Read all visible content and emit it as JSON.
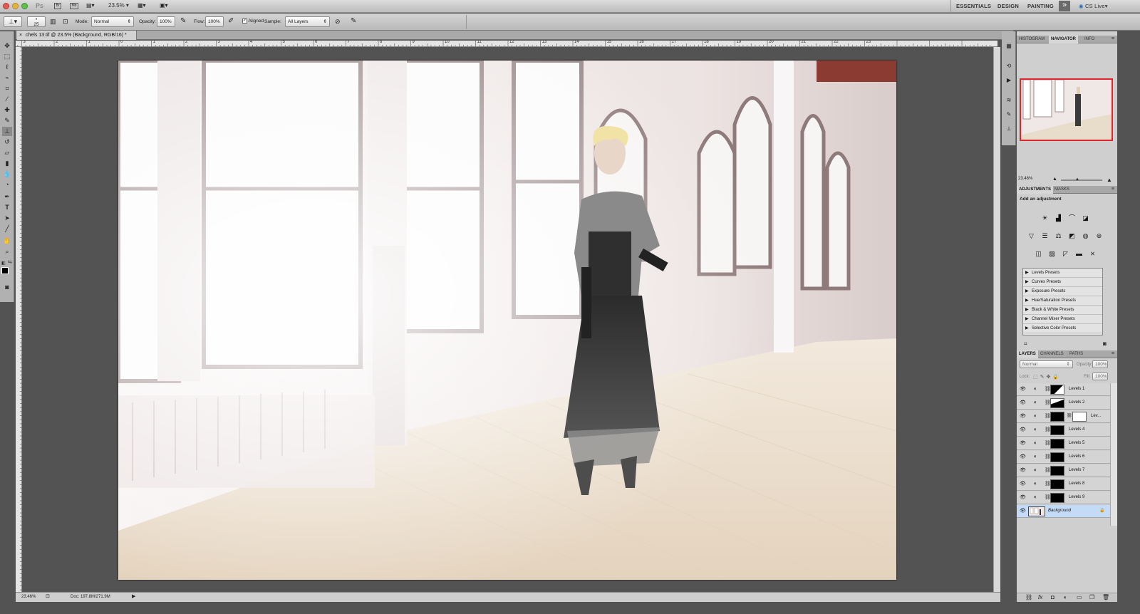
{
  "app": {
    "name": "Ps",
    "zoom_menu": "23.5%",
    "workspaces": [
      "ESSENTIALS",
      "DESIGN",
      "PAINTING"
    ],
    "overflow": "»",
    "cs_live": "CS Live"
  },
  "options": {
    "brush_size": "25",
    "mode_label": "Mode:",
    "mode_value": "Normal",
    "opacity_label": "Opacity:",
    "opacity_value": "100%",
    "flow_label": "Flow:",
    "flow_value": "100%",
    "aligned_label": "Aligned",
    "sample_label": "Sample:",
    "sample_value": "All Layers"
  },
  "document": {
    "tab_title": "chels 13.tif @ 23.5% (Background, RGB/16) *",
    "ruler_numbers": [
      "3",
      "2",
      "1",
      "0",
      "1",
      "2",
      "3",
      "4",
      "5",
      "6",
      "7",
      "8",
      "9",
      "10",
      "11",
      "12",
      "13",
      "14",
      "15",
      "16",
      "17",
      "18",
      "19",
      "20",
      "21",
      "22",
      "23"
    ]
  },
  "status": {
    "zoom": "23.46%",
    "doc_info": "Doc: 197.8M/271.9M"
  },
  "navigator": {
    "tabs": [
      "HISTOGRAM",
      "NAVIGATOR",
      "INFO"
    ],
    "zoom": "23.46%"
  },
  "adjustments": {
    "tabs": [
      "ADJUSTMENTS",
      "MASKS"
    ],
    "heading": "Add an adjustment",
    "presets": [
      "Levels Presets",
      "Curves Presets",
      "Exposure Presets",
      "Hue/Saturation Presets",
      "Black & White Presets",
      "Channel Mixer Presets",
      "Selective Color Presets"
    ]
  },
  "layers": {
    "tabs": [
      "LAYERS",
      "CHANNELS",
      "PATHS"
    ],
    "blend_mode": "Normal",
    "opacity_label": "Opacity:",
    "opacity_value": "100%",
    "lock_label": "Lock:",
    "fill_label": "Fill:",
    "fill_value": "100%",
    "items": [
      "Levels 1",
      "Levels 2",
      "Lev...",
      "Levels 4",
      "Levels 5",
      "Levels 6",
      "Levels 7",
      "Levels 8",
      "Levels 9",
      "Background"
    ],
    "selected_index": 9
  },
  "colors": {
    "accent": "#c3dbf6",
    "nav_view_box": "#e0242a",
    "wall_trim": "#8d7778",
    "floor": "#e9dcc9"
  }
}
